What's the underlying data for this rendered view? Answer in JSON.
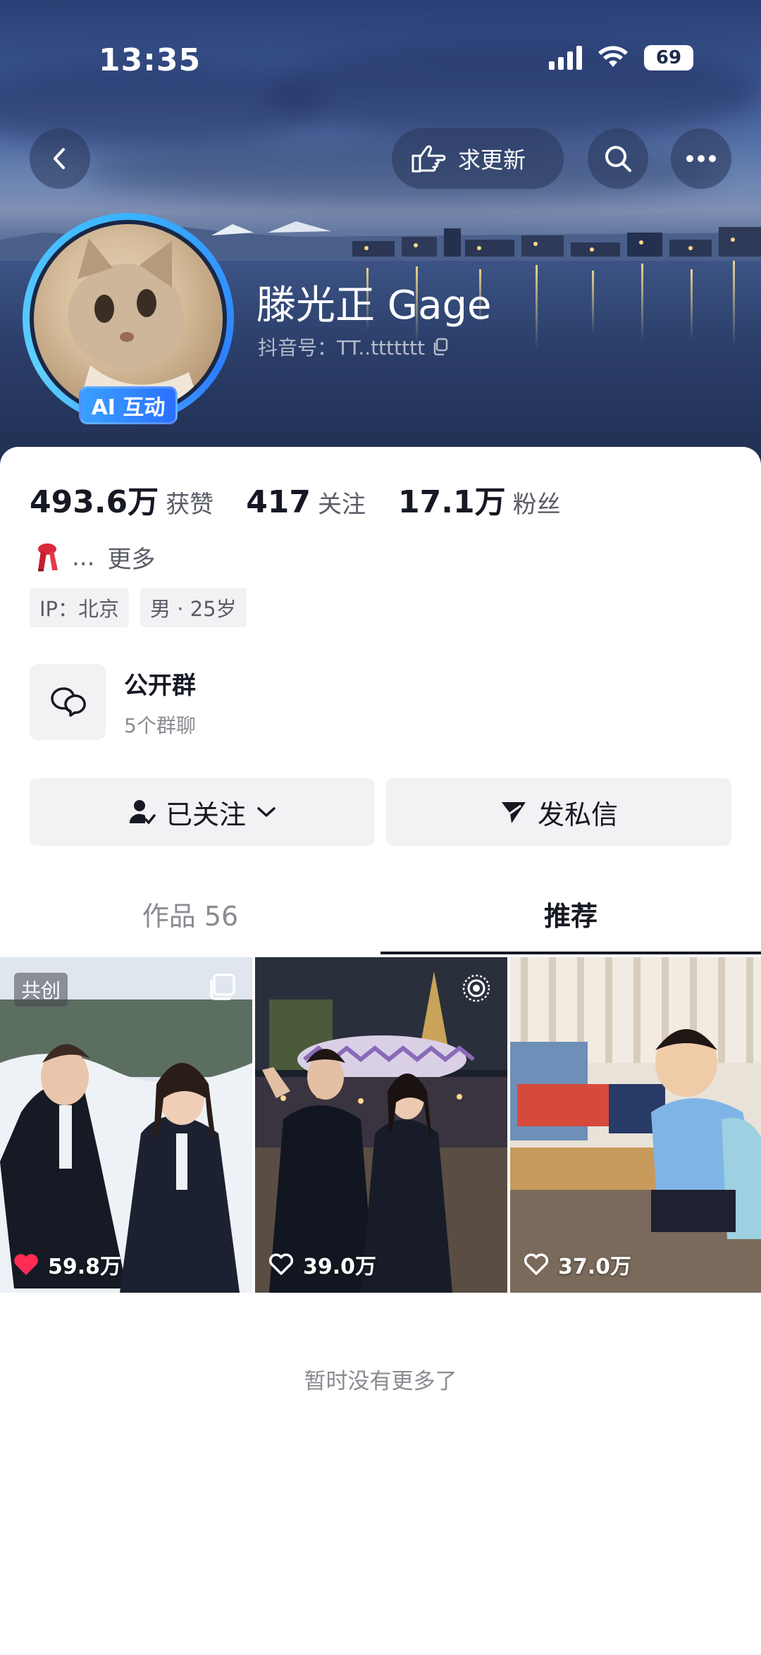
{
  "status_bar": {
    "time": "13:35",
    "battery": "69"
  },
  "header": {
    "back_icon": "chevron-left-icon",
    "request_update_label": "求更新",
    "search_icon": "search-icon",
    "more_icon": "more-dots-icon"
  },
  "profile": {
    "name": "滕光正 Gage",
    "douyin_id": "抖音号：TT..ttttttt",
    "ai_badge": "AI 互动"
  },
  "stats": [
    {
      "value": "493.6万",
      "label": "获赞"
    },
    {
      "value": "417",
      "label": "关注"
    },
    {
      "value": "17.1万",
      "label": "粉丝"
    }
  ],
  "bio": {
    "ellipsis": "...",
    "more": "更多"
  },
  "tags": [
    "IP：北京",
    "男 · 25岁"
  ],
  "group": {
    "title": "公开群",
    "subtitle": "5个群聊"
  },
  "actions": {
    "following": "已关注",
    "message": "发私信"
  },
  "tabs": {
    "works": "作品 56",
    "recommend": "推荐"
  },
  "videos": [
    {
      "likes": "59.8万",
      "badge": "共创",
      "liked": true
    },
    {
      "likes": "39.0万",
      "liked": false
    },
    {
      "likes": "37.0万",
      "liked": false
    }
  ],
  "footer": {
    "no_more": "暂时没有更多了"
  },
  "colors": {
    "accent_blue": "#2d7dff",
    "like_red": "#fe2c55"
  }
}
